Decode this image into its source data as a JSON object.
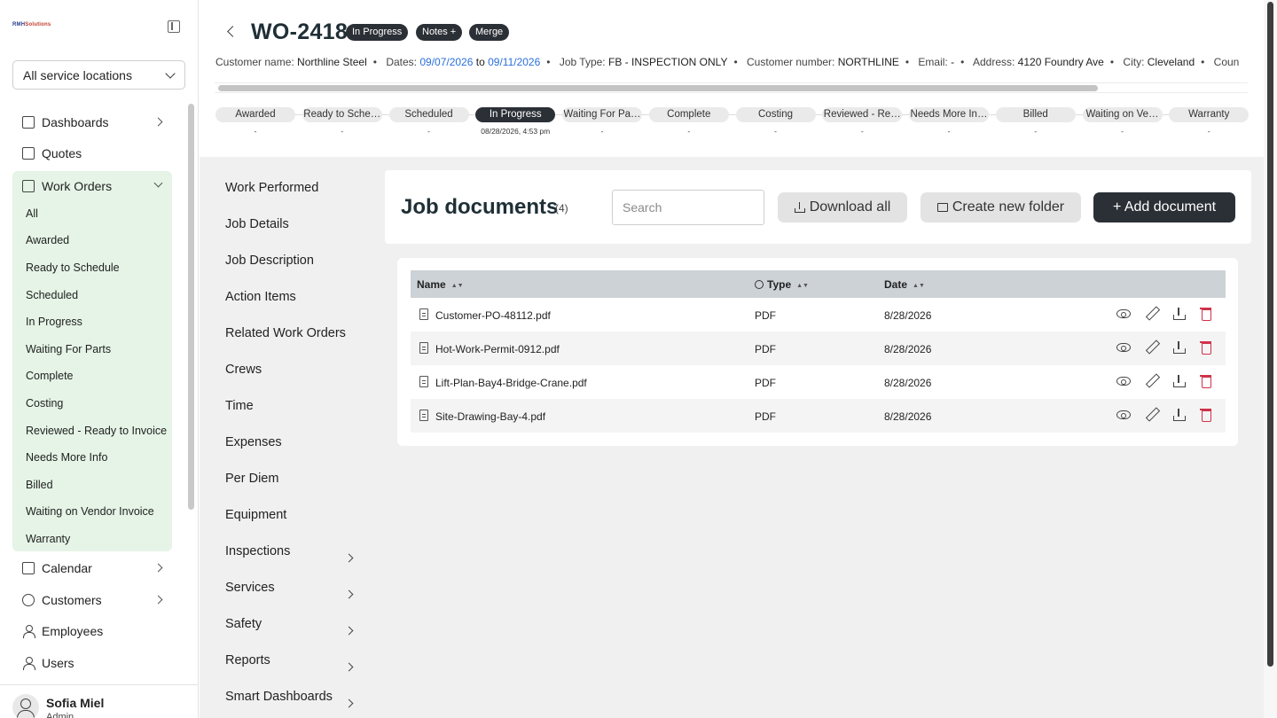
{
  "sidebar": {
    "logo_line1": "RMH",
    "logo_line2": "Solutions",
    "location_select": "All service locations",
    "nav": {
      "dashboards": "Dashboards",
      "quotes": "Quotes",
      "work_orders": "Work Orders",
      "calendar": "Calendar",
      "customers": "Customers",
      "employees": "Employees",
      "users": "Users"
    },
    "work_order_items": [
      "All",
      "Awarded",
      "Ready to Schedule",
      "Scheduled",
      "In Progress",
      "Waiting For Parts",
      "Complete",
      "Costing",
      "Reviewed - Ready to Invoice",
      "Needs More Info",
      "Billed",
      "Waiting on Vendor Invoice",
      "Warranty"
    ],
    "user": {
      "name": "Sofia Miel",
      "role": "Admin"
    }
  },
  "header": {
    "title": "WO-2418",
    "badges": [
      "In Progress",
      "Notes +",
      "Merge"
    ],
    "meta": {
      "customer_name_label": "Customer name:",
      "customer_name": "Northline Steel",
      "dates_label": "Dates:",
      "date_from": "09/07/2026",
      "date_to_word": "to",
      "date_to": "09/11/2026",
      "job_type_label": "Job Type:",
      "job_type": "FB - INSPECTION ONLY",
      "customer_number_label": "Customer number:",
      "customer_number": "NORTHLINE",
      "email_label": "Email:",
      "email": "-",
      "address_label": "Address:",
      "address": "4120 Foundry Ave",
      "city_label": "City:",
      "city": "Cleveland",
      "country_label": "Coun"
    },
    "stages": [
      {
        "label": "Awarded",
        "date": "-"
      },
      {
        "label": "Ready to Sche…",
        "date": "-"
      },
      {
        "label": "Scheduled",
        "date": "-"
      },
      {
        "label": "In Progress",
        "date": "08/28/2026, 4:53 pm"
      },
      {
        "label": "Waiting For Pa…",
        "date": "-"
      },
      {
        "label": "Complete",
        "date": "-"
      },
      {
        "label": "Costing",
        "date": "-"
      },
      {
        "label": "Reviewed - Re…",
        "date": "-"
      },
      {
        "label": "Needs More In…",
        "date": "-"
      },
      {
        "label": "Billed",
        "date": "-"
      },
      {
        "label": "Waiting on Ve…",
        "date": "-"
      },
      {
        "label": "Warranty",
        "date": "-"
      }
    ],
    "active_stage": "In Progress"
  },
  "sections": [
    "Work Performed",
    "Job Details",
    "Job Description",
    "Action Items",
    "Related Work Orders",
    "Crews",
    "Time",
    "Expenses",
    "Per Diem",
    "Equipment",
    "Inspections",
    "Services",
    "Safety",
    "Reports",
    "Smart Dashboards"
  ],
  "documents": {
    "title": "Job documents",
    "count": "(4)",
    "search_placeholder": "Search",
    "download_all": "Download all",
    "create_folder": "Create new folder",
    "add_document": "+ Add document",
    "columns": {
      "name": "Name",
      "type": "Type",
      "date": "Date"
    },
    "rows": [
      {
        "name": "Customer-PO-48112.pdf",
        "type": "PDF",
        "date": "8/28/2026"
      },
      {
        "name": "Hot-Work-Permit-0912.pdf",
        "type": "PDF",
        "date": "8/28/2026"
      },
      {
        "name": "Lift-Plan-Bay4-Bridge-Crane.pdf",
        "type": "PDF",
        "date": "8/28/2026"
      },
      {
        "name": "Site-Drawing-Bay-4.pdf",
        "type": "PDF",
        "date": "8/28/2026"
      }
    ]
  },
  "colors": {
    "accent_dark": "#2b3036",
    "sidebar_active": "#e5f4e6",
    "link": "#2a6fdb",
    "danger": "#d0324a"
  }
}
